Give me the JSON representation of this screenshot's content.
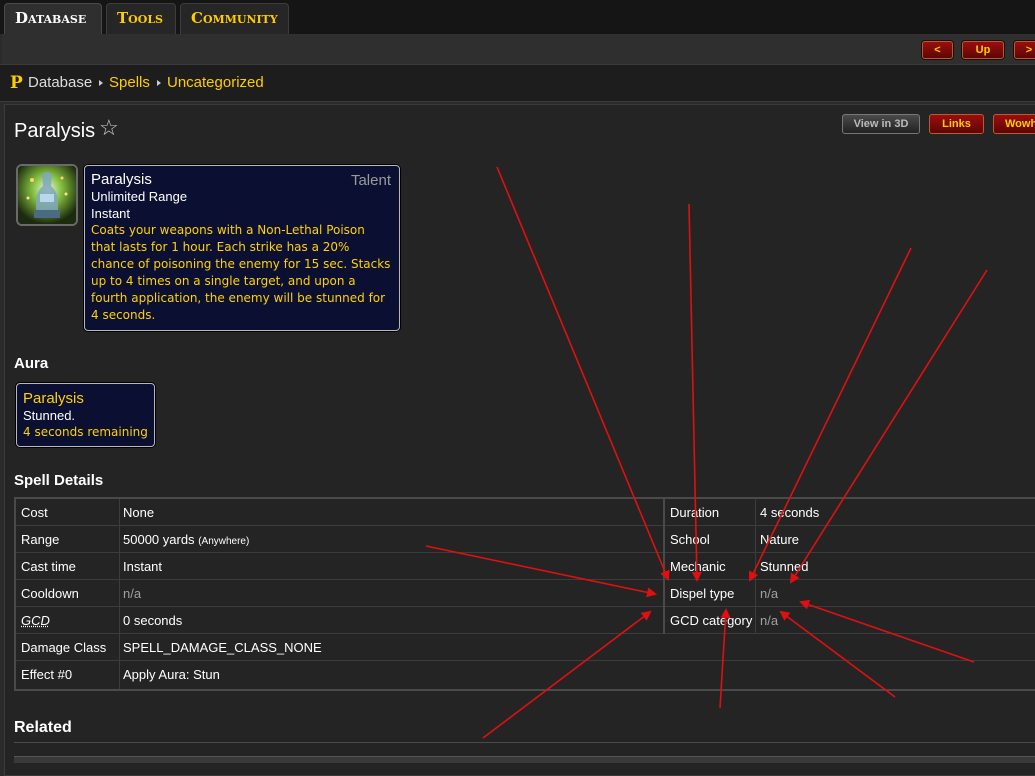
{
  "tabs": {
    "database": "Database",
    "tools": "Tools",
    "community": "Community"
  },
  "nav": {
    "prev": "<",
    "up": "Up",
    "next": ">"
  },
  "breadcrumb": {
    "logo": "P",
    "items": [
      "Database",
      "Spells",
      "Uncategorized"
    ]
  },
  "page": {
    "title": "Paralysis"
  },
  "header_buttons": {
    "view3d": "View in 3D",
    "links": "Links",
    "wowhead": "Wowh"
  },
  "tooltip": {
    "name": "Paralysis",
    "tag": "Talent",
    "range": "Unlimited Range",
    "cast": "Instant",
    "description_lines": [
      "Coats your weapons with a Non-Lethal Poison",
      "that lasts for 1 hour. Each strike has a 20%",
      "chance of poisoning the enemy for 15 sec. Stacks",
      "up to 4 times on a single target, and upon a",
      "fourth application, the enemy will be stunned for",
      "4 seconds."
    ]
  },
  "aura": {
    "heading": "Aura",
    "name": "Paralysis",
    "effect": "Stunned.",
    "remaining": "4 seconds remaining"
  },
  "spell_details": {
    "heading": "Spell Details",
    "left_rows": [
      {
        "label": "Cost",
        "value": "None"
      },
      {
        "label": "Range",
        "value": "50000 yards",
        "note": "(Anywhere)"
      },
      {
        "label": "Cast time",
        "value": "Instant"
      },
      {
        "label": "Cooldown",
        "value": "n/a"
      },
      {
        "label": "GCD",
        "value": "0 seconds"
      },
      {
        "label": "Damage Class",
        "value": "SPELL_DAMAGE_CLASS_NONE"
      },
      {
        "label": "Effect #0",
        "value": "Apply Aura: Stun"
      }
    ],
    "right_rows": [
      {
        "label": "Duration",
        "value": "4 seconds"
      },
      {
        "label": "School",
        "value": "Nature"
      },
      {
        "label": "Mechanic",
        "value": "Stunned"
      },
      {
        "label": "Dispel type",
        "value": "n/a"
      },
      {
        "label": "GCD category",
        "value": "n/a"
      }
    ]
  },
  "related": {
    "heading": "Related"
  },
  "colors": {
    "accent": "#ffcc00",
    "button_red": "#8b0b0b",
    "tooltip_bg": "#0b1033",
    "annotation_arrow": "#e01010"
  }
}
